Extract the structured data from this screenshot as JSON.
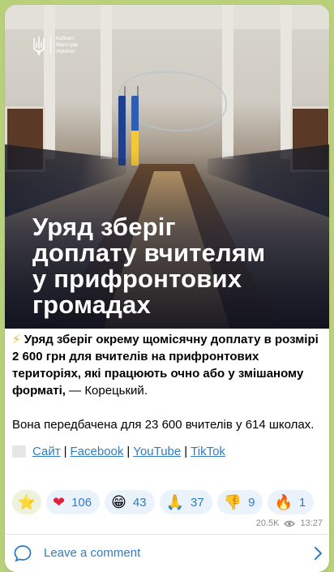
{
  "post": {
    "image": {
      "logo_lines": [
        "Кабінет",
        "Міністрів",
        "України"
      ],
      "headline_lines": [
        "Уряд зберіг",
        "доплату вчителям",
        "у прифронтових",
        "громадах"
      ]
    },
    "text": {
      "bolt_icon": "⚡",
      "bold_part": "Уряд зберіг окрему щомісячну доплату в розмірі 2 600 грн для вчителів на прифронтових територіях, які працюють очно або у змішаному форматі,",
      "attribution": " — Корецький.",
      "paragraph2": "Вона передбачена для 23 600  вчителів у 614 школах."
    },
    "links": [
      {
        "label": "Сайт"
      },
      {
        "label": "Facebook"
      },
      {
        "label": "YouTube"
      },
      {
        "label": "TikTok"
      }
    ],
    "link_separator": "|",
    "reactions": [
      {
        "icon": "star-icon",
        "emoji": "⭐",
        "count": ""
      },
      {
        "icon": "heart-icon",
        "emoji": "❤",
        "count": "106"
      },
      {
        "icon": "grin-icon",
        "emoji": "😁",
        "count": "43"
      },
      {
        "icon": "pray-icon",
        "emoji": "🙏",
        "count": "37"
      },
      {
        "icon": "thumbs-down-icon",
        "emoji": "👎",
        "count": "9"
      },
      {
        "icon": "fire-icon",
        "emoji": "🔥",
        "count": "1"
      }
    ],
    "views": "20.5K",
    "time": "13:27"
  },
  "comment_bar": {
    "label": "Leave a comment"
  },
  "colors": {
    "background": "#b9d07a",
    "link": "#2f7cc4",
    "reaction_pill": "#eaf3fb"
  }
}
